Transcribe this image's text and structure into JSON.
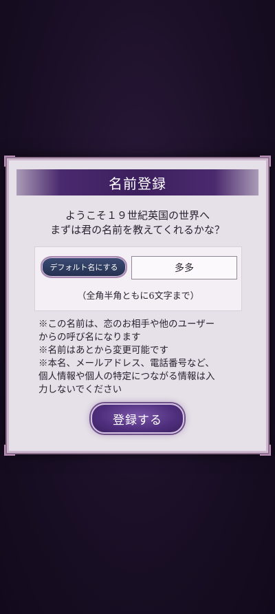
{
  "dialog": {
    "title": "名前登録",
    "welcome_line1": "ようこそ１９世紀英国の世界へ",
    "welcome_line2": "まずは君の名前を教えてくれるかな？",
    "default_name_button": "デフォルト名にする",
    "name_value": "多多",
    "hint": "（全角半角ともに6文字まで）",
    "notes": [
      "※この名前は、恋のお相手や他のユーザー",
      "からの呼び名になります",
      "※名前はあとから変更可能です",
      "※本名、メールアドレス、電話番号など、",
      "個人情報や個人の特定につながる情報は入",
      "力しないでください"
    ],
    "register_button": "登録する"
  }
}
